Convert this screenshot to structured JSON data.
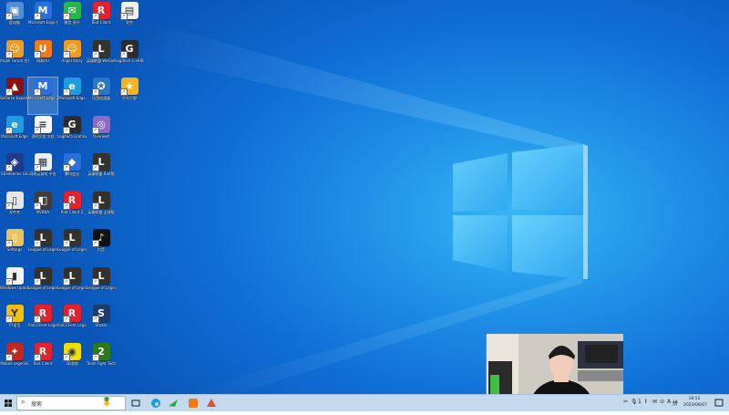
{
  "desktop": {
    "icons": [
      {
        "label": "此电脑",
        "color": "#4f8fd8",
        "glyph": "▣"
      },
      {
        "label": "Microsoft Edge 插件",
        "color": "#2a6fe0",
        "glyph": "M"
      },
      {
        "label": "微信 多开",
        "color": "#26b64a",
        "glyph": "✉"
      },
      {
        "label": "Riot Client",
        "color": "#e8202c",
        "glyph": "R"
      },
      {
        "label": "文件",
        "color": "#f2f2f2",
        "glyph": "▤"
      },
      {
        "label": "Angel Forum 应用",
        "color": "#f29a20",
        "glyph": "☺"
      },
      {
        "label": "网易UU",
        "color": "#f07a18",
        "glyph": "U"
      },
      {
        "label": "Angel Story",
        "color": "#f29a20",
        "glyph": "☺"
      },
      {
        "label": "英雄联盟 WeGame版",
        "color": "#33322d",
        "glyph": "L"
      },
      {
        "label": "Logitech G HUB",
        "color": "#2c2c2c",
        "glyph": "G"
      },
      {
        "label": "GeForce Experience",
        "color": "#8b1010",
        "glyph": "▲"
      },
      {
        "label": "Microsoft Edge 2",
        "color": "#2a6fe0",
        "glyph": "M"
      },
      {
        "label": "Microsoft Edge",
        "color": "#1b9de2",
        "glyph": "e"
      },
      {
        "label": "迅游加速器",
        "color": "#2a76c8",
        "glyph": "✪"
      },
      {
        "label": "大众打野",
        "color": "#f5b41e",
        "glyph": "★"
      },
      {
        "label": "Microsoft Edge",
        "color": "#1b9de2",
        "glyph": "e"
      },
      {
        "label": "说明文档 文档",
        "color": "#f5f5f5",
        "glyph": "≡"
      },
      {
        "label": "Logitech Gaming",
        "color": "#2b2b2b",
        "glyph": "G"
      },
      {
        "label": "Overwolf",
        "color": "#8a6bc9",
        "glyph": "◎"
      },
      {
        "label": "SteelSeries GG",
        "color": "#233a8a",
        "glyph": "◈"
      },
      {
        "label": "网易云游戏 平台",
        "color": "#e6edf5",
        "glyph": "▦"
      },
      {
        "label": "腾讯会议",
        "color": "#2a6fe0",
        "glyph": "◆"
      },
      {
        "label": "英雄联盟 Riot版",
        "color": "#33322d",
        "glyph": "L"
      },
      {
        "label": "文件夹",
        "color": "#e6e6e6",
        "glyph": "▯"
      },
      {
        "label": "NVIDIA",
        "color": "#3d3d3d",
        "glyph": "◧"
      },
      {
        "label": "Riot Client 2",
        "color": "#e8202c",
        "glyph": "R"
      },
      {
        "label": "英雄联盟 全球版",
        "color": "#33322d",
        "glyph": "L"
      },
      {
        "label": "Settings",
        "color": "#e9c35c",
        "glyph": "▯"
      },
      {
        "label": "League of Legends",
        "color": "#33322d",
        "glyph": "L"
      },
      {
        "label": "League of Legends 2",
        "color": "#33322d",
        "glyph": "L"
      },
      {
        "label": "抖音",
        "color": "#111111",
        "glyph": "♪"
      },
      {
        "label": "Windows Update 助手",
        "color": "#f2f2f2",
        "glyph": "▮"
      },
      {
        "label": "League of Legends",
        "color": "#33322d",
        "glyph": "L"
      },
      {
        "label": "League of Legends",
        "color": "#33322d",
        "glyph": "L"
      },
      {
        "label": "League of Legends",
        "color": "#33322d",
        "glyph": "L"
      },
      {
        "label": "YY语音",
        "color": "#f2c000",
        "glyph": "Y"
      },
      {
        "label": "Riot Client Legends",
        "color": "#e8202c",
        "glyph": "R"
      },
      {
        "label": "Riot Client Legends",
        "color": "#e8202c",
        "glyph": "R"
      },
      {
        "label": "Steam",
        "color": "#1b3d6e",
        "glyph": "S"
      },
      {
        "label": "Mobile Legends",
        "color": "#c2281c",
        "glyph": "✦"
      },
      {
        "label": "Riot Client",
        "color": "#e8202c",
        "glyph": "R"
      },
      {
        "label": "3D游戏",
        "color": "#f0e000",
        "glyph": "◉"
      },
      {
        "label": "Team Fight Tactics 2",
        "color": "#2d7a1a",
        "glyph": "2"
      }
    ]
  },
  "taskbar": {
    "search_placeholder": "搜索",
    "tray_items": [
      "✂",
      "🎙",
      "1",
      "𝄃",
      "✉",
      "⊙",
      "A"
    ],
    "ime": "拼",
    "time": "18:52",
    "date": "2023/06/07"
  },
  "webcam": {
    "alt": "webcam overlay"
  }
}
